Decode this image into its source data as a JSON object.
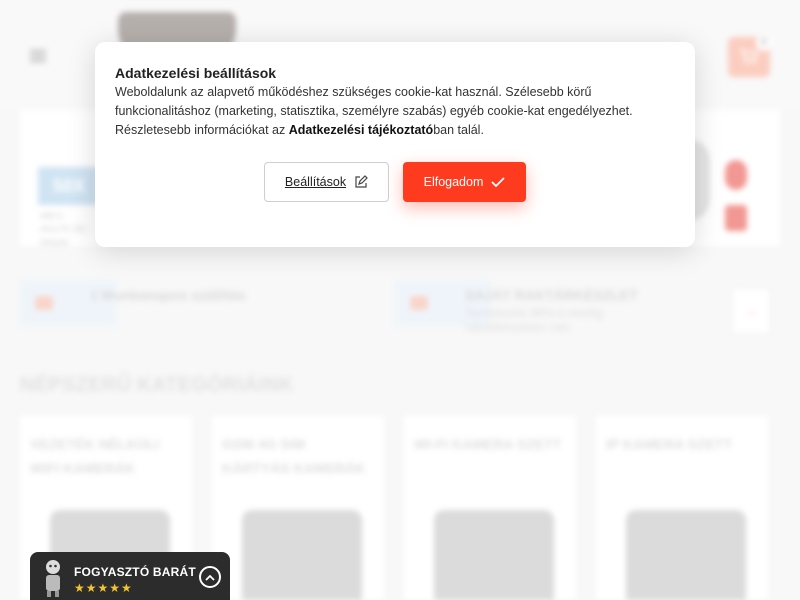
{
  "header": {
    "cart_count": "0"
  },
  "hero": {
    "badge": "50X",
    "caption": "Wifi 5 · 4G/LTE SD kártyás"
  },
  "features": [
    {
      "title": "1 Munkanapos szállítás",
      "subtitle": ""
    },
    {
      "title": "SAJÁT RAKTÁRKÉSZLET",
      "subtitle": "Termékeink 98%-a mindig raktárkészleten van."
    }
  ],
  "section": {
    "title": "NÉPSZERŰ KATEGÓRIÁINK"
  },
  "categories": [
    {
      "title": "VEZETÉK NÉLKÜLI WIFI KAMERÁK"
    },
    {
      "title": "GSM 4G SIM KÁRTYÁS KAMERÁK"
    },
    {
      "title": "WI-FI KAMERA SZETT"
    },
    {
      "title": "IP KAMERA SZETT"
    }
  ],
  "consent": {
    "title": "Adatkezelési beállítások",
    "body_part1": "Weboldalunk az alapvető működéshez szükséges cookie-kat használ. Szélesebb körű funkcionalitáshoz (marketing, statisztika, személyre szabás) egyéb cookie-kat engedélyezhet. Részletesebb információkat az ",
    "body_link": "Adatkezelési tájékoztató",
    "body_part2": "ban talál.",
    "settings_label": "Beállítások",
    "accept_label": "Elfogadom",
    "accept_color": "#ff3b1f"
  },
  "consumer_badge": {
    "name": "FOGYASZTÓ BARÁT",
    "stars": "★★★★★",
    "rating": 5
  },
  "icons": {
    "menu": "hamburger-icon",
    "cart": "cart-icon",
    "settings_edit": "edit-icon",
    "accept": "checkmark-icon",
    "badge_toggle": "chevron-up-icon"
  }
}
